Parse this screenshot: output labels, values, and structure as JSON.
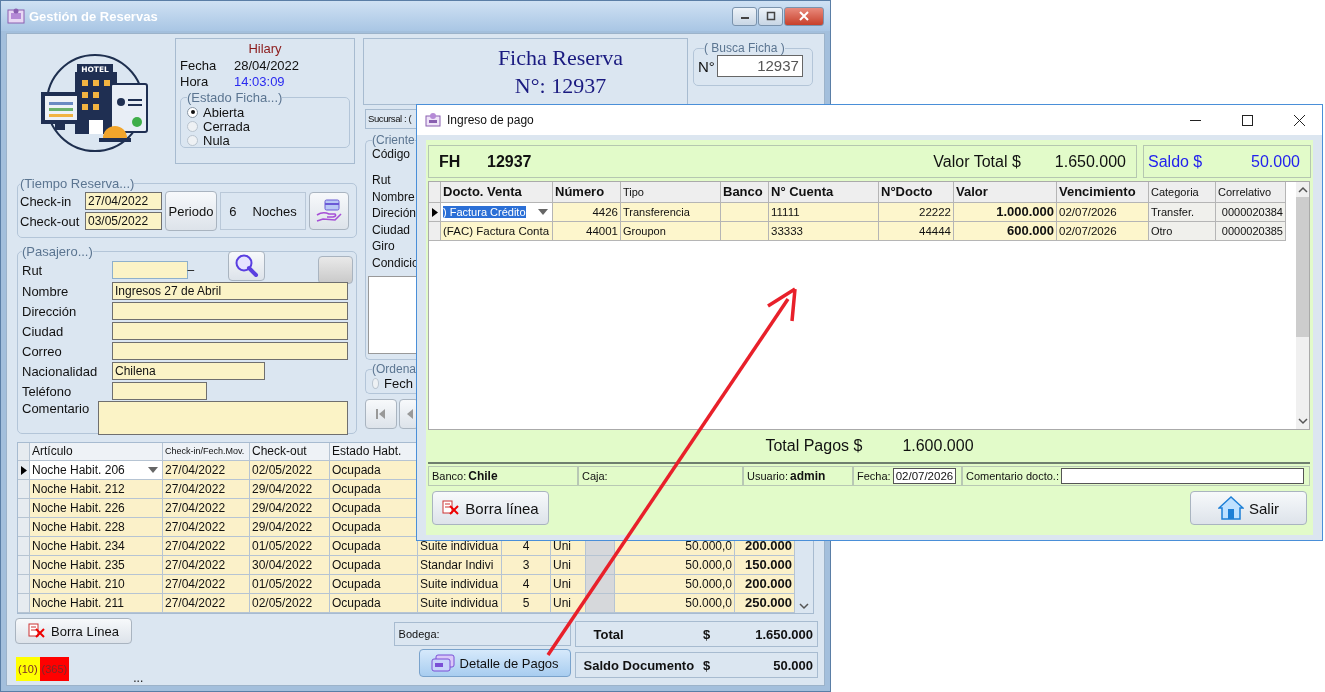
{
  "main_window": {
    "title": "Gestión de Reservas",
    "logo_text": "HOTEL"
  },
  "info": {
    "user": "Hilary",
    "rows": [
      {
        "label": "Fecha",
        "value": "28/04/2022",
        "kind": "date"
      },
      {
        "label": "Hora",
        "value": "14:03:09",
        "kind": "time"
      }
    ]
  },
  "estado_ficha": {
    "legend": "(Estado Ficha...)",
    "options": [
      {
        "label": "Abierta",
        "selected": true
      },
      {
        "label": "Cerrada",
        "selected": false
      },
      {
        "label": "Nula",
        "selected": false
      }
    ]
  },
  "ficha": {
    "title": "Ficha Reserva",
    "number": "N°: 12937"
  },
  "busca_ficha": {
    "legend": "( Busca Ficha )",
    "label": "N°",
    "value": "12937"
  },
  "tiempo_reserva": {
    "legend": "(Tiempo Reserva...)",
    "fields": [
      {
        "label": "Check-in",
        "value": "27/04/2022"
      },
      {
        "label": "Check-out",
        "value": "03/05/2022"
      }
    ],
    "periodo_button": "Periodo",
    "nights": "6",
    "nights_label": "Noches"
  },
  "pasajero": {
    "legend": "(Pasajero...)",
    "rut_label": "Rut",
    "rut_separator": "–",
    "fields": [
      {
        "label": "Nombre",
        "value": "Ingresos 27 de Abril",
        "kind": "text"
      },
      {
        "label": "Dirección",
        "kind": "text"
      },
      {
        "label": "Ciudad",
        "kind": "text"
      },
      {
        "label": "Correo",
        "kind": "text"
      },
      {
        "label": "Nacionalidad",
        "value": "Chilena",
        "kind": "text"
      },
      {
        "label": "Teléfono",
        "kind": "text"
      },
      {
        "label": "Comentario",
        "kind": "textarea"
      }
    ]
  },
  "sucursal": "Sucursal : (",
  "cliente": {
    "legend": "(Criente",
    "labels": [
      "Código",
      "Rut",
      "Nombre",
      "Direción",
      "Ciudad",
      "Giro",
      "Condicio"
    ]
  },
  "ordena": {
    "legend": "(Ordena",
    "options": [
      {
        "label": "Fech",
        "selected": false
      }
    ]
  },
  "items_table": {
    "columns": [
      "Artículo",
      "Check-in/Fech.Mov.",
      "Check-out",
      "Estado Habt."
    ],
    "rows": [
      {
        "selected": true,
        "articulo": "Noche Habit. 206",
        "check_in": "27/04/2022",
        "check_out": "02/05/2022",
        "estado": "Ocupada"
      },
      {
        "selected": false,
        "articulo": "Noche Habit. 212",
        "check_in": "27/04/2022",
        "check_out": "29/04/2022",
        "estado": "Ocupada"
      },
      {
        "selected": false,
        "articulo": "Noche Habit. 226",
        "check_in": "27/04/2022",
        "check_out": "29/04/2022",
        "estado": "Ocupada"
      },
      {
        "selected": false,
        "articulo": "Noche Habit. 228",
        "check_in": "27/04/2022",
        "check_out": "29/04/2022",
        "estado": "Ocupada"
      },
      {
        "selected": false,
        "articulo": "Noche Habit. 234",
        "check_in": "27/04/2022",
        "check_out": "01/05/2022",
        "estado": "Ocupada",
        "tipo": "Suite individua",
        "cantidad": "4",
        "unidad": "Uni",
        "precio": "50.000,0",
        "total": "200.000"
      },
      {
        "selected": false,
        "articulo": "Noche Habit. 235",
        "check_in": "27/04/2022",
        "check_out": "30/04/2022",
        "estado": "Ocupada",
        "tipo": "Standar Indivi",
        "cantidad": "3",
        "unidad": "Uni",
        "precio": "50.000,0",
        "total": "150.000"
      },
      {
        "selected": false,
        "articulo": "Noche Habit. 210",
        "check_in": "27/04/2022",
        "check_out": "01/05/2022",
        "estado": "Ocupada",
        "tipo": "Suite individua",
        "cantidad": "4",
        "unidad": "Uni",
        "precio": "50.000,0",
        "total": "200.000"
      },
      {
        "selected": false,
        "articulo": "Noche Habit. 211",
        "check_in": "27/04/2022",
        "check_out": "02/05/2022",
        "estado": "Ocupada",
        "tipo": "Suite individua",
        "cantidad": "5",
        "unidad": "Uni",
        "precio": "50.000,0",
        "total": "250.000"
      }
    ]
  },
  "borra_linea": "Borra Línea",
  "bodega": "Bodega:",
  "detalle_button": "Detalle de Pagos",
  "totals": [
    {
      "label": "Total",
      "currency": "$",
      "value": "1.650.000"
    },
    {
      "label": "Saldo Documento",
      "currency": "$",
      "value": "50.000"
    }
  ],
  "counters": [
    {
      "text": "(10)",
      "color": "#ffff00"
    },
    {
      "text": "(365)",
      "color": "#ff0000"
    }
  ],
  "status_text": "...",
  "dialog": {
    "title": "Ingreso de pago",
    "doc_type": "FH",
    "doc_number": "12937",
    "valor_total_label": "Valor Total $",
    "valor_total": "1.650.000",
    "saldo_label": "Saldo $",
    "saldo": "50.000",
    "table": {
      "columns": [
        "Docto. Venta",
        "Número",
        "Tipo",
        "Banco",
        "N° Cuenta",
        "N°Docto",
        "Valor",
        "Vencimiento",
        "Categoria",
        "Correlativo"
      ],
      "rows": [
        {
          "selected": true,
          "docto": ") Factura Crédito",
          "numero": "4426",
          "tipo": "Transferencia",
          "cuenta": "11111",
          "ndocto": "22222",
          "valor": "1.000.000",
          "vencimiento": "02/07/2026",
          "categoria": "Transfer.",
          "correlativo": "0000020384"
        },
        {
          "selected": false,
          "docto": "(FAC) Factura Conta",
          "numero": "44001",
          "tipo": "Groupon",
          "cuenta": "33333",
          "ndocto": "44444",
          "valor": "600.000",
          "vencimiento": "02/07/2026",
          "categoria": "Otro",
          "correlativo": "0000020385"
        }
      ]
    },
    "total_pagos_label": "Total Pagos $",
    "total_pagos": "1.600.000",
    "info": {
      "banco_label": "Banco:",
      "banco": "Chile",
      "caja_label": "Caja:",
      "usuario_label": "Usuario:",
      "usuario": "admin",
      "fecha_label": "Fecha:",
      "fecha": "02/07/2026",
      "comentario_label": "Comentario docto.:"
    },
    "buttons": [
      {
        "label": "Borra línea",
        "kind": "delete"
      },
      {
        "label": "Salir",
        "kind": "exit"
      }
    ]
  }
}
